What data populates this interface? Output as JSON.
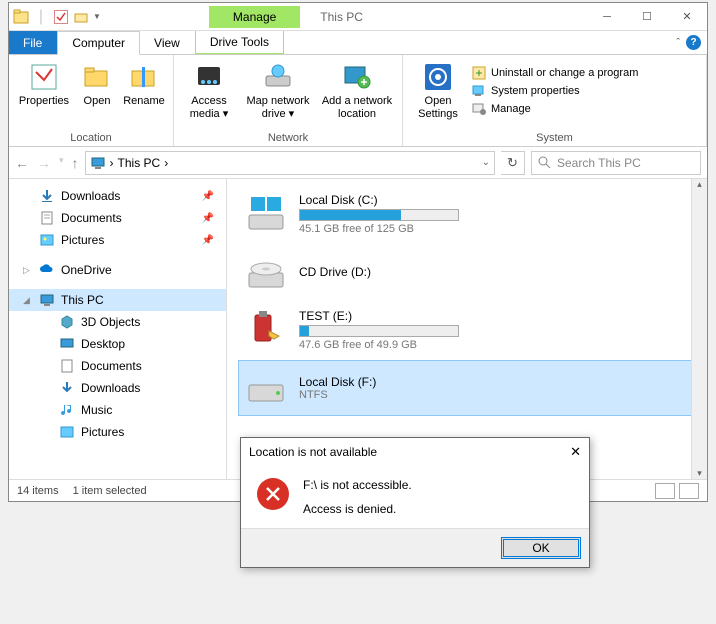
{
  "title": "This PC",
  "manage_tab": "Manage",
  "tabs": {
    "file": "File",
    "computer": "Computer",
    "view": "View",
    "tools": "Drive Tools"
  },
  "ribbon": {
    "location": {
      "label": "Location",
      "properties": "Properties",
      "open": "Open",
      "rename": "Rename"
    },
    "network": {
      "label": "Network",
      "access": "Access media ▾",
      "map": "Map network drive ▾",
      "add": "Add a network location"
    },
    "system": {
      "label": "System",
      "open": "Open Settings",
      "uninstall": "Uninstall or change a program",
      "props": "System properties",
      "manage": "Manage"
    }
  },
  "nav": {
    "breadcrumb": "This PC",
    "sep": "›",
    "search_placeholder": "Search This PC"
  },
  "tree": {
    "downloads": "Downloads",
    "documents": "Documents",
    "pictures": "Pictures",
    "onedrive": "OneDrive",
    "thispc": "This PC",
    "objects3d": "3D Objects",
    "desktop": "Desktop",
    "documents2": "Documents",
    "downloads2": "Downloads",
    "music": "Music",
    "pictures2": "Pictures"
  },
  "drives": [
    {
      "name": "Local Disk (C:)",
      "sub": "45.1 GB free of 125 GB",
      "fill": 64,
      "bar": true
    },
    {
      "name": "CD Drive (D:)",
      "sub": "",
      "bar": false
    },
    {
      "name": "TEST (E:)",
      "sub": "47.6 GB free of 49.9 GB",
      "fill": 6,
      "bar": true
    },
    {
      "name": "Local Disk (F:)",
      "sub": "NTFS",
      "bar": false,
      "selected": true
    }
  ],
  "status": {
    "count": "14 items",
    "sel": "1 item selected"
  },
  "dialog": {
    "title": "Location is not available",
    "line1": "F:\\ is not accessible.",
    "line2": "Access is denied.",
    "ok": "OK"
  }
}
